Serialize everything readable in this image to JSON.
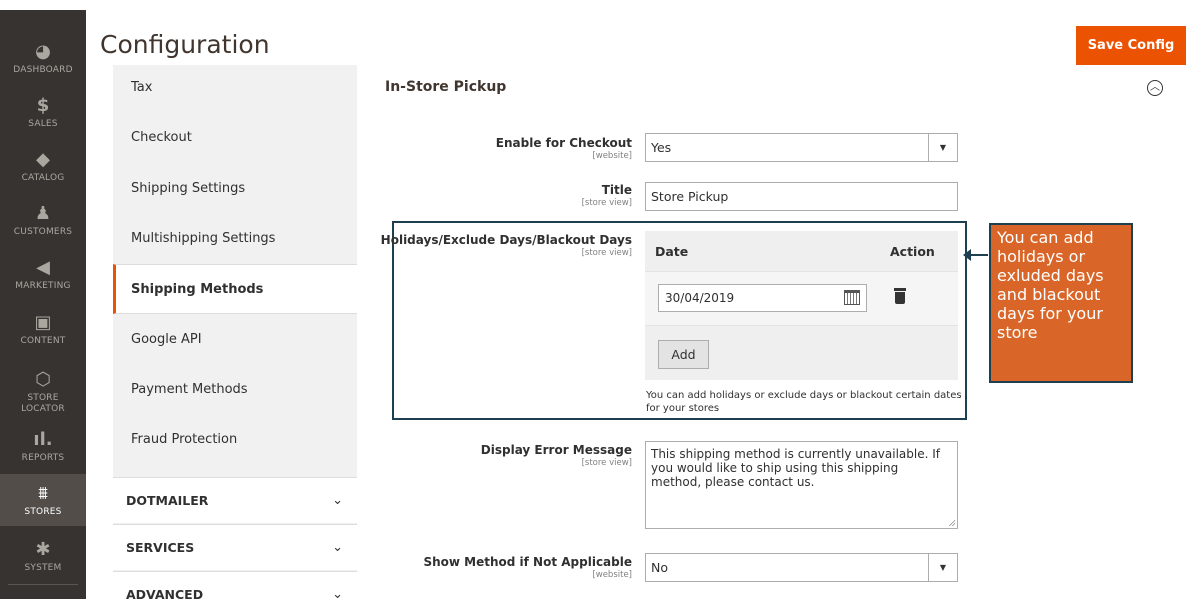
{
  "nav": {
    "items": [
      {
        "label": "DASHBOARD",
        "icon": "dashboard-icon"
      },
      {
        "label": "SALES",
        "icon": "dollar-icon"
      },
      {
        "label": "CATALOG",
        "icon": "box-icon"
      },
      {
        "label": "CUSTOMERS",
        "icon": "person-icon"
      },
      {
        "label": "MARKETING",
        "icon": "megaphone-icon"
      },
      {
        "label": "CONTENT",
        "icon": "content-icon"
      },
      {
        "label": "STORE LOCATOR",
        "icon": "hexagon-icon"
      },
      {
        "label": "REPORTS",
        "icon": "bar-chart-icon"
      },
      {
        "label": "STORES",
        "icon": "store-icon"
      },
      {
        "label": "SYSTEM",
        "icon": "gear-icon"
      }
    ]
  },
  "header": {
    "title": "Configuration",
    "save_label": "Save Config"
  },
  "tabs": {
    "items": [
      "Tax",
      "Checkout",
      "Shipping Settings",
      "Multishipping Settings",
      "Shipping Methods",
      "Google API",
      "Payment Methods",
      "Fraud Protection"
    ],
    "active": "Shipping Methods",
    "groups": [
      "DOTMAILER",
      "SERVICES",
      "ADVANCED"
    ]
  },
  "section": {
    "title": "In-Store Pickup"
  },
  "fields": {
    "enable": {
      "label": "Enable for Checkout",
      "scope": "[website]",
      "value": "Yes"
    },
    "title": {
      "label": "Title",
      "scope": "[store view]",
      "value": "Store Pickup"
    },
    "holidays": {
      "label": "Holidays/Exclude Days/Blackout Days",
      "scope": "[store view]",
      "col_date": "Date",
      "col_action": "Action",
      "date_value": "30/04/2019",
      "add_label": "Add",
      "note": "You can add holidays or exclude days or blackout certain dates for your stores"
    },
    "error": {
      "label": "Display Error Message",
      "scope": "[store view]",
      "value": "This shipping method is currently unavailable. If you would like to ship using this shipping method, please contact us."
    },
    "show_method": {
      "label": "Show Method if Not Applicable",
      "scope": "[website]",
      "value": "No"
    }
  },
  "callout": {
    "text": "You can add holidays or exluded days and blackout days for your store"
  },
  "colors": {
    "accent": "#eb5202",
    "callout": "#d96628",
    "callout_border": "#1d3f4f",
    "nav_bg": "#373330"
  }
}
